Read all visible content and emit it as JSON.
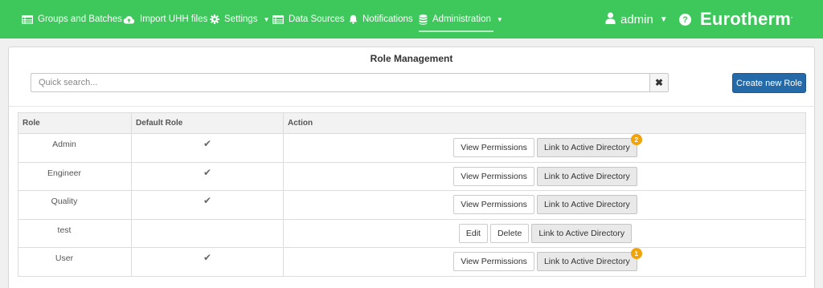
{
  "nav": {
    "items": [
      {
        "label": "Groups and Batches",
        "icon": "table-icon"
      },
      {
        "label": "Import UHH files",
        "icon": "cloud-upload-icon"
      },
      {
        "label": "Settings",
        "icon": "gear-icon",
        "dropdown": true
      },
      {
        "label": "Data Sources",
        "icon": "table-icon"
      },
      {
        "label": "Notifications",
        "icon": "bell-icon"
      },
      {
        "label": "Administration",
        "icon": "database-icon",
        "dropdown": true,
        "active": true
      }
    ],
    "user": "admin",
    "help": "?",
    "brand": "Eurotherm",
    "brand_mark": "."
  },
  "panel": {
    "title": "Role Management",
    "search_placeholder": "Quick search...",
    "search_value": "",
    "clear_label": "✖",
    "create_button": "Create new Role"
  },
  "table": {
    "headers": [
      "Role",
      "Default Role",
      "Action"
    ],
    "check_glyph": "✔",
    "rows": [
      {
        "role": "Admin",
        "default": true,
        "actions": [
          {
            "label": "View Permissions"
          },
          {
            "label": "Link to Active Directory",
            "gray": true,
            "badge": "2"
          }
        ]
      },
      {
        "role": "Engineer",
        "default": true,
        "actions": [
          {
            "label": "View Permissions"
          },
          {
            "label": "Link to Active Directory",
            "gray": true
          }
        ]
      },
      {
        "role": "Quality",
        "default": true,
        "actions": [
          {
            "label": "View Permissions"
          },
          {
            "label": "Link to Active Directory",
            "gray": true
          }
        ]
      },
      {
        "role": "test",
        "default": false,
        "actions": [
          {
            "label": "Edit"
          },
          {
            "label": "Delete"
          },
          {
            "label": "Link to Active Directory",
            "gray": true
          }
        ]
      },
      {
        "role": "User",
        "default": true,
        "actions": [
          {
            "label": "View Permissions"
          },
          {
            "label": "Link to Active Directory",
            "gray": true,
            "badge": "1"
          }
        ]
      }
    ]
  },
  "colors": {
    "navbar": "#3ec85c",
    "primary": "#2469a8",
    "badge": "#f0a30a"
  }
}
